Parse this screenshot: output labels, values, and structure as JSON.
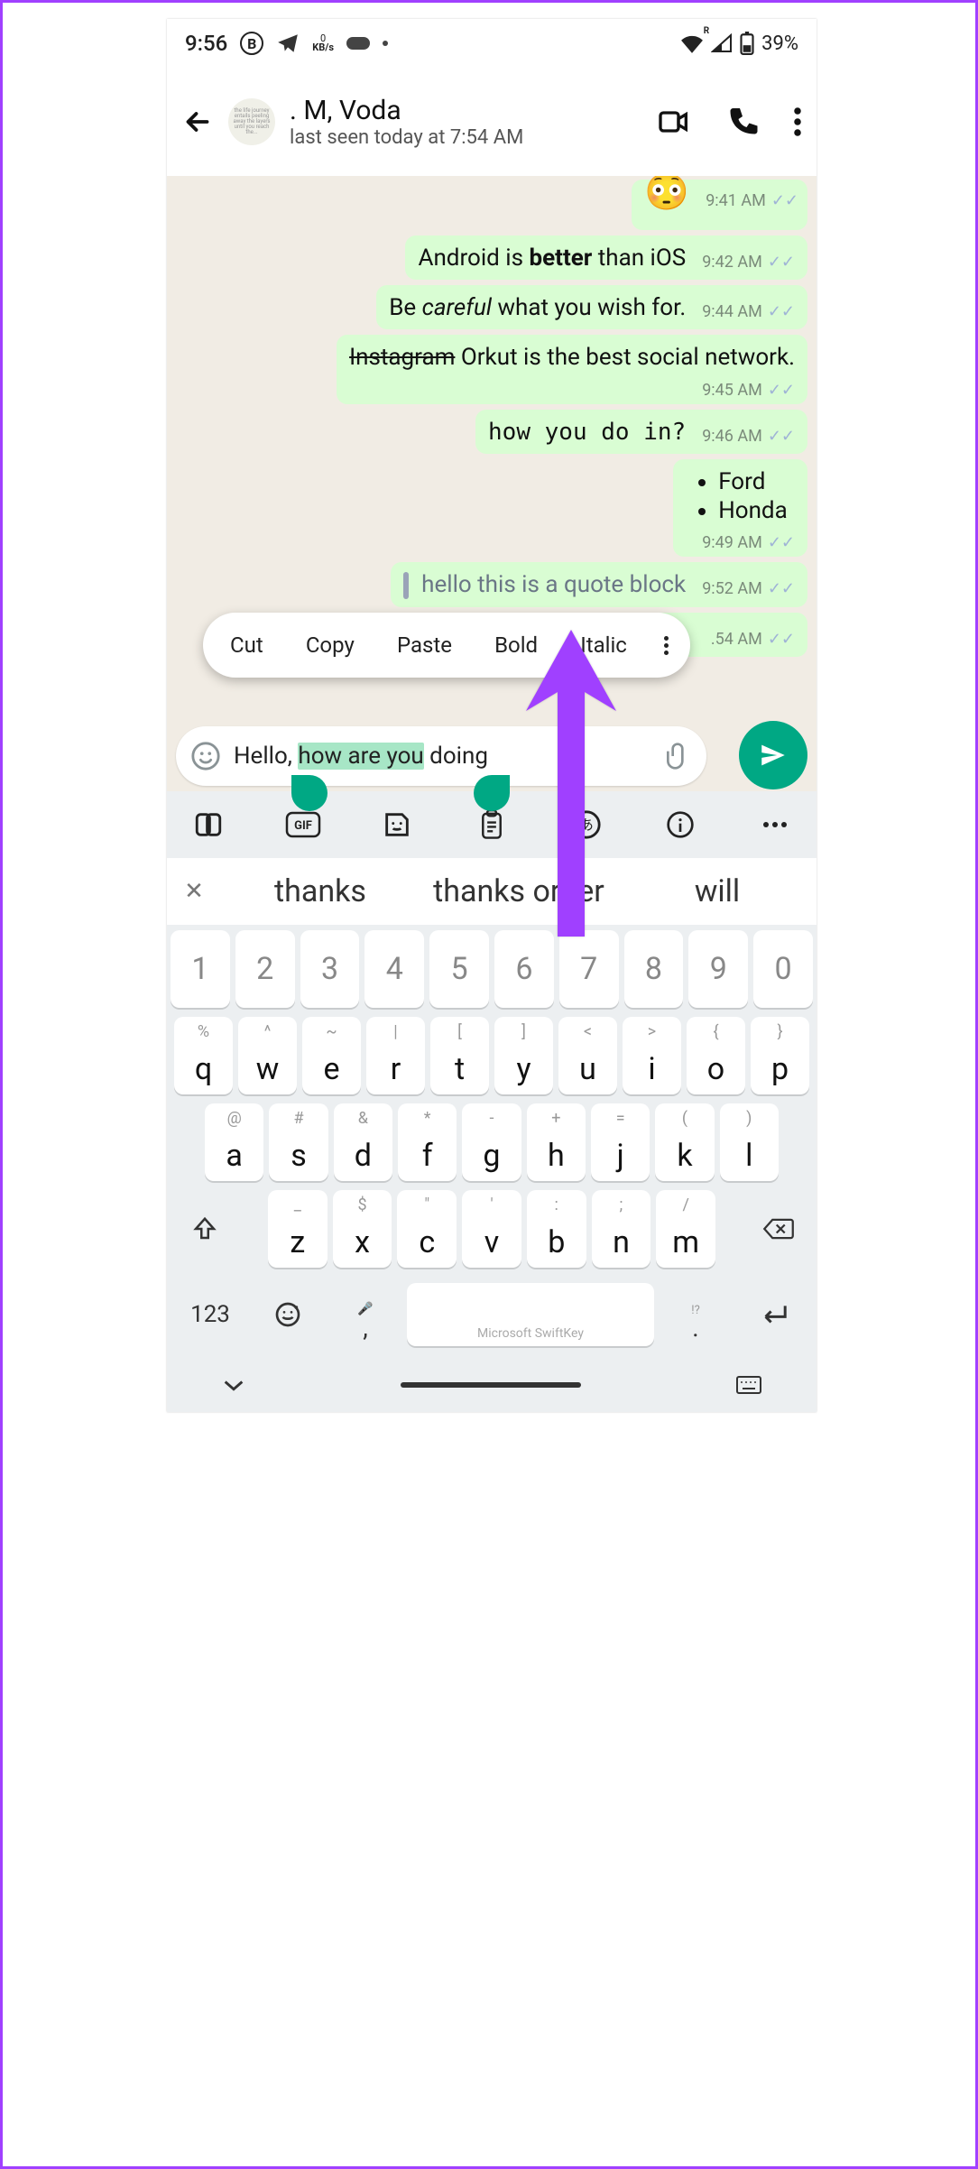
{
  "status": {
    "time": "9:56",
    "kbs_top": "0",
    "kbs_bottom": "KB/s",
    "battery": "39%",
    "wifi_letter": "R"
  },
  "chat": {
    "contact_name": ". M, Voda",
    "last_seen": "last seen today at 7:54 AM"
  },
  "messages": {
    "m0_time": "9:41 AM",
    "m1_pre": "Android is ",
    "m1_bold": "better",
    "m1_post": " than iOS",
    "m1_time": "9:42 AM",
    "m2_pre": "Be ",
    "m2_italic": "careful",
    "m2_post": " what you wish for.",
    "m2_time": "9:44 AM",
    "m3_strike": "Instagram",
    "m3_post": " Orkut is the best social network.",
    "m3_time": "9:45 AM",
    "m4_mono": "how you do in?",
    "m4_time": "9:46 AM",
    "m5_li1": "Ford",
    "m5_li2": "Honda",
    "m5_time": "9:49 AM",
    "m6_quote": "hello this is a quote block",
    "m6_time": "9:52 AM",
    "m7_time_cut": ".54 AM"
  },
  "context_menu": {
    "cut": "Cut",
    "copy": "Copy",
    "paste": "Paste",
    "bold": "Bold",
    "italic": "Italic"
  },
  "input": {
    "pre": "Hello, ",
    "selected": "how are you",
    "post": " doing"
  },
  "suggestions": {
    "s1": "thanks",
    "s2": "thanks order",
    "s3": "will"
  },
  "keyboard": {
    "r1": [
      "1",
      "2",
      "3",
      "4",
      "5",
      "6",
      "7",
      "8",
      "9",
      "0"
    ],
    "r2_sec": [
      "%",
      "^",
      "~",
      "|",
      "[",
      "]",
      "<",
      ">",
      "{",
      "}"
    ],
    "r2": [
      "q",
      "w",
      "e",
      "r",
      "t",
      "y",
      "u",
      "i",
      "o",
      "p"
    ],
    "r3_sec": [
      "@",
      "#",
      "&",
      "*",
      "-",
      "+",
      "=",
      "(",
      ")"
    ],
    "r3": [
      "a",
      "s",
      "d",
      "f",
      "g",
      "h",
      "j",
      "k",
      "l"
    ],
    "r4_sec": [
      "_",
      "$",
      "\"",
      "'",
      ":",
      ";",
      "/"
    ],
    "r4": [
      "z",
      "x",
      "c",
      "v",
      "b",
      "n",
      "m"
    ],
    "mode": "123",
    "comma": ",",
    "period": ".",
    "period_alt": "!?",
    "brand": "Microsoft SwiftKey"
  }
}
